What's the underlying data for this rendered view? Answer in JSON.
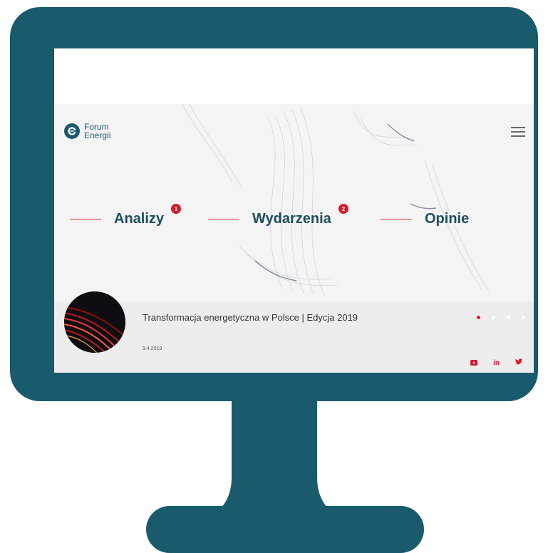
{
  "colors": {
    "monitor": "#1a5a6d",
    "accent": "#d8182b",
    "nav_text": "#1d4e5e",
    "hero_bg": "#f4f4f5"
  },
  "logo": {
    "line1": "Forum",
    "line2": "Energii",
    "icon": "forum-energii-logo-icon"
  },
  "header": {
    "menu_icon": "hamburger-icon"
  },
  "nav": [
    {
      "label": "Analizy",
      "badge": "1"
    },
    {
      "label": "Wydarzenia",
      "badge": "2"
    },
    {
      "label": "Opinie"
    }
  ],
  "feature": {
    "title": "Transformacja energetyczna w Polsce | Edycja 2019",
    "date": "9.4.2019",
    "slides_total": 4,
    "active_slide": 1
  },
  "socials": [
    {
      "icon": "youtube-icon"
    },
    {
      "icon": "linkedin-icon",
      "text": "in"
    },
    {
      "icon": "twitter-icon"
    }
  ]
}
